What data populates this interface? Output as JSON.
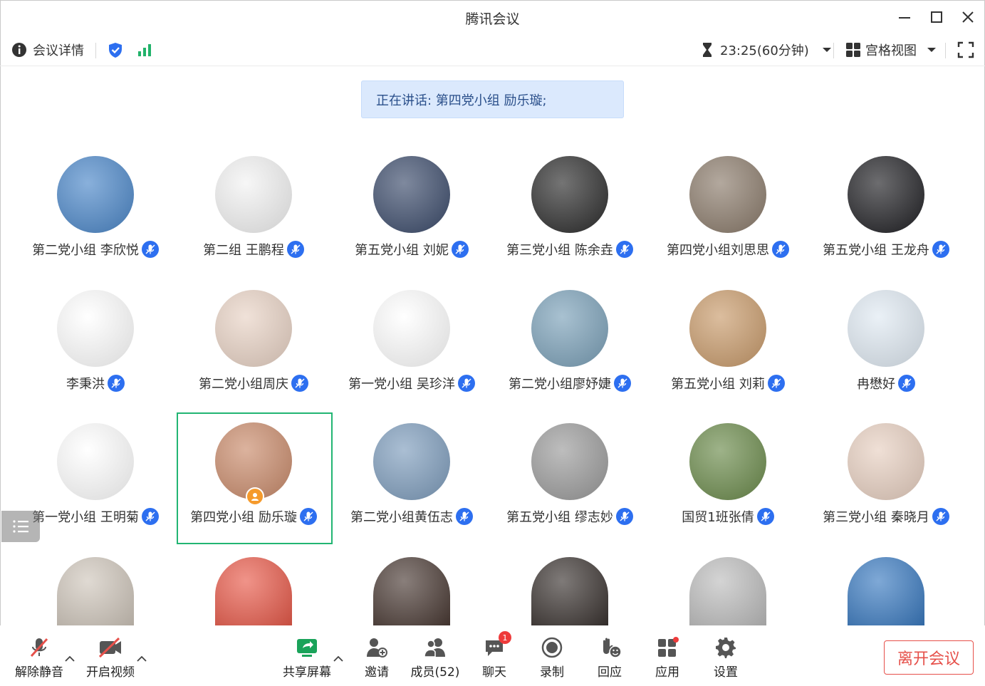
{
  "window": {
    "title": "腾讯会议"
  },
  "toolbar": {
    "meeting_details_label": "会议详情",
    "timer_label": "23:25(60分钟)",
    "view_label": "宫格视图"
  },
  "speaking": {
    "text": "正在讲话: 第四党小组 励乐璇;"
  },
  "participants": [
    {
      "name": "第二党小组 李欣悦",
      "avatar": "rain-umbrella-art",
      "color": "#4a86c8"
    },
    {
      "name": "第二组 王鹏程",
      "avatar": "cat-with-calligraphy",
      "color": "#f2f2f2"
    },
    {
      "name": "第五党小组 刘妮",
      "avatar": "young-man-photo",
      "color": "#3a4a6a"
    },
    {
      "name": "第三党小组 陈余垚",
      "avatar": "black-white-figure",
      "color": "#2a2a2a"
    },
    {
      "name": "第四党小组刘思思",
      "avatar": "dog-with-sunglasses",
      "color": "#8a7a6a"
    },
    {
      "name": "第五党小组 王龙舟",
      "avatar": "gray-cat",
      "color": "#1e1e22"
    },
    {
      "name": "李秉洪",
      "avatar": "cartoon-doodle",
      "color": "#ffffff"
    },
    {
      "name": "第二党小组周庆",
      "avatar": "girl-illustration",
      "color": "#e8d2c4"
    },
    {
      "name": "第一党小组 吴珍洋",
      "avatar": "bunny-doodle",
      "color": "#ffffff"
    },
    {
      "name": "第二党小组廖妤婕",
      "avatar": "moon-over-sea",
      "color": "#7aa0b8"
    },
    {
      "name": "第五党小组 刘莉",
      "avatar": "woman-at-beach",
      "color": "#c89a6a"
    },
    {
      "name": "冉懋好",
      "avatar": "anime-sketch",
      "color": "#dfe9f2"
    },
    {
      "name": "第一党小组 王明菊",
      "avatar": "power-cartoon",
      "color": "#ffffff"
    },
    {
      "name": "第四党小组 励乐璇",
      "avatar": "girl-eating",
      "color": "#c98a6a",
      "host": true
    },
    {
      "name": "第二党小组黄伍志",
      "avatar": "blue-sky",
      "color": "#7d9cbc"
    },
    {
      "name": "第五党小组 缪志妙",
      "avatar": "couple-photo",
      "color": "#9a9a9a"
    },
    {
      "name": "国贸1班张倩",
      "avatar": "lamb-with-flowers",
      "color": "#6a8a4a"
    },
    {
      "name": "第三党小组 秦晓月",
      "avatar": "woman-portrait",
      "color": "#e7cfc0"
    },
    {
      "name": "",
      "avatar": "puppy",
      "color": "#cfc6bb"
    },
    {
      "name": "",
      "avatar": "crayon-shin-chan",
      "color": "#e85a4a"
    },
    {
      "name": "",
      "avatar": "woman-peace-sign",
      "color": "#4a3a34"
    },
    {
      "name": "",
      "avatar": "man-in-suit",
      "color": "#3a3330"
    },
    {
      "name": "",
      "avatar": "woman-black-white",
      "color": "#bdbdbd"
    },
    {
      "name": "",
      "avatar": "young-man-blue",
      "color": "#3a7ac0"
    }
  ],
  "bottom": {
    "unmute_label": "解除静音",
    "video_label": "开启视频",
    "share_label": "共享屏幕",
    "invite_label": "邀请",
    "members_label": "成员(52)",
    "chat_label": "聊天",
    "chat_badge": "1",
    "record_label": "录制",
    "react_label": "回应",
    "apps_label": "应用",
    "settings_label": "设置",
    "leave_label": "离开会议"
  },
  "colors": {
    "accent": "#2d6ff0",
    "active_speaker": "#22b573",
    "leave": "#e6504a",
    "banner": "#dbe9fd"
  }
}
